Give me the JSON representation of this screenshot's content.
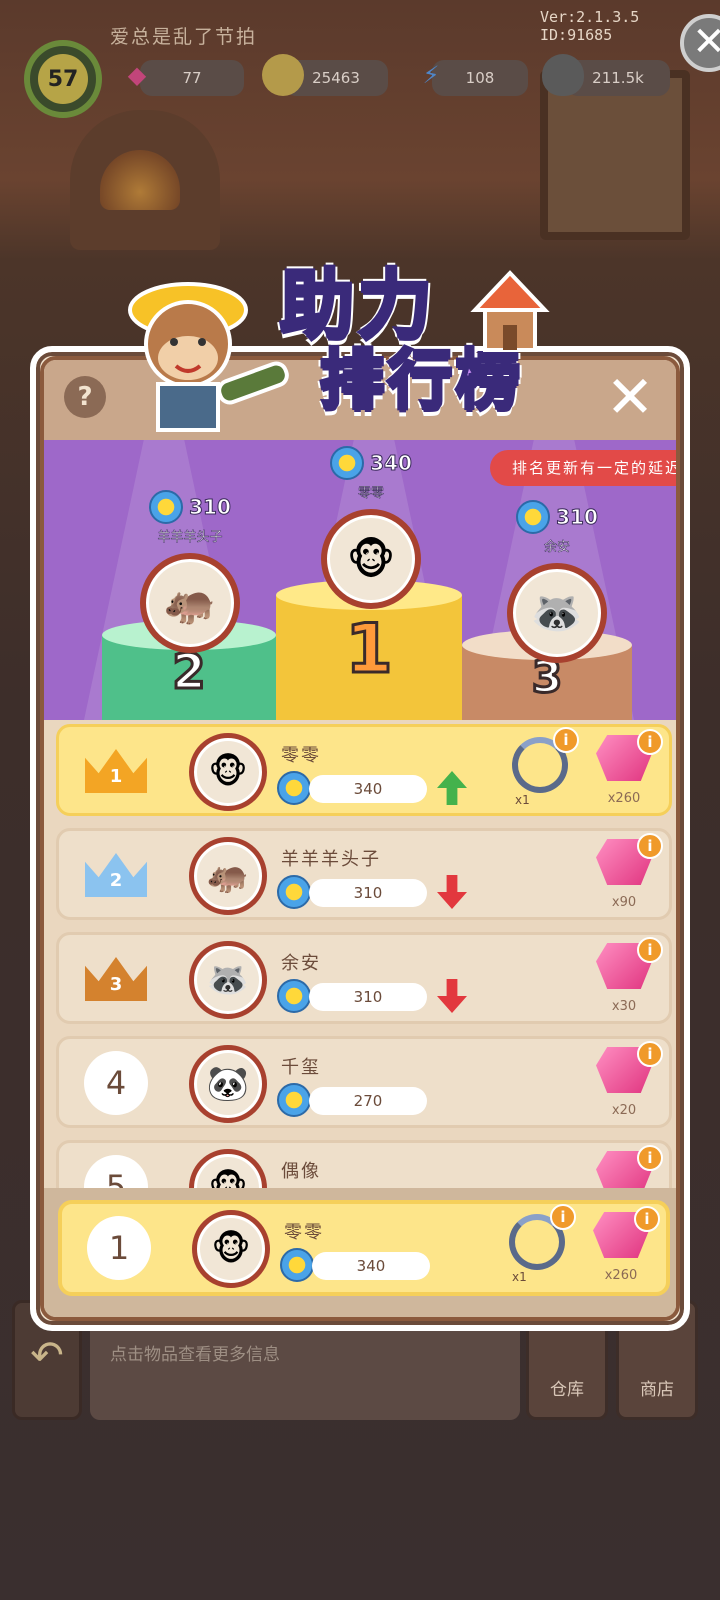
{
  "hud": {
    "player_name": "爱总是乱了节拍",
    "version": "Ver:2.1.3.5 ID:91685",
    "level": "57",
    "gems": "77",
    "coins": "25463",
    "energy": "108",
    "seeds": "211.5k"
  },
  "title": {
    "line1": "助力",
    "line2": "排行榜"
  },
  "notice": "排名更新有一定的延迟",
  "podium": [
    {
      "rank": "1",
      "name": "零零",
      "score": "340"
    },
    {
      "rank": "2",
      "name": "羊羊羊头子",
      "score": "310"
    },
    {
      "rank": "3",
      "name": "余安",
      "score": "310"
    }
  ],
  "rows": [
    {
      "rank": "1",
      "name": "零零",
      "score": "340",
      "trend": "up",
      "frame_qty": "x1",
      "gem_qty": "x260"
    },
    {
      "rank": "2",
      "name": "羊羊羊头子",
      "score": "310",
      "trend": "down",
      "gem_qty": "x90"
    },
    {
      "rank": "3",
      "name": "余安",
      "score": "310",
      "trend": "down",
      "gem_qty": "x30"
    },
    {
      "rank": "4",
      "name": "千玺",
      "score": "270",
      "gem_qty": "x20"
    },
    {
      "rank": "5",
      "name": "偶像"
    }
  ],
  "self_row": {
    "rank": "1",
    "name": "零零",
    "score": "340",
    "frame_qty": "x1",
    "gem_qty": "x260"
  },
  "bottom": {
    "hint": "点击物品查看更多信息",
    "warehouse": "仓库",
    "shop": "商店"
  },
  "colors": {
    "stage": "#9e68c9",
    "notice": "#e24a48",
    "first_row": "#fde58a"
  },
  "icons": [
    "help-icon",
    "close-icon",
    "flower-icon",
    "gem-icon",
    "frame-icon",
    "info-icon",
    "crown-icon",
    "trend-up-icon",
    "trend-down-icon"
  ]
}
